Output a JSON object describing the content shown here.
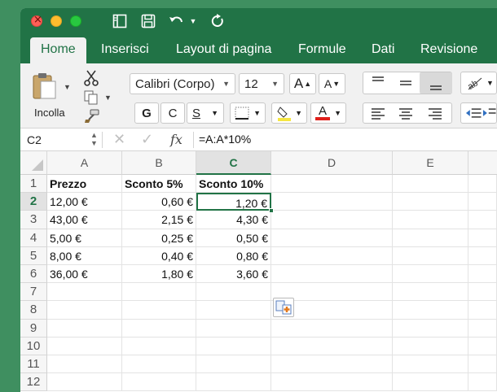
{
  "window": {
    "tabs": [
      "Home",
      "Inserisci",
      "Layout di pagina",
      "Formule",
      "Dati",
      "Revisione"
    ],
    "active_tab": "Home"
  },
  "ribbon": {
    "paste_label": "Incolla",
    "font_name": "Calibri (Corpo)",
    "font_size": "12",
    "grow_font": "A",
    "shrink_font": "A",
    "bold": "G",
    "italic": "C",
    "underline": "S",
    "font_color": "A"
  },
  "formula_bar": {
    "name_box": "C2",
    "fx": "fx",
    "formula": "=A:A*10%"
  },
  "grid": {
    "columns": [
      "A",
      "B",
      "C",
      "D",
      "E"
    ],
    "rows": [
      "1",
      "2",
      "3",
      "4",
      "5",
      "6",
      "7",
      "8",
      "9",
      "10",
      "11",
      "12"
    ],
    "selected_cell": "C2",
    "headers": [
      "Prezzo",
      "Sconto 5%",
      "Sconto 10%"
    ],
    "data": [
      [
        "12,00 €",
        "0,60 €",
        "1,20 €"
      ],
      [
        "43,00 €",
        "2,15 €",
        "4,30 €"
      ],
      [
        "5,00 €",
        "0,25 €",
        "0,50 €"
      ],
      [
        "8,00 €",
        "0,40 €",
        "0,80 €"
      ],
      [
        "36,00 €",
        "1,80 €",
        "3,60 €"
      ]
    ]
  }
}
